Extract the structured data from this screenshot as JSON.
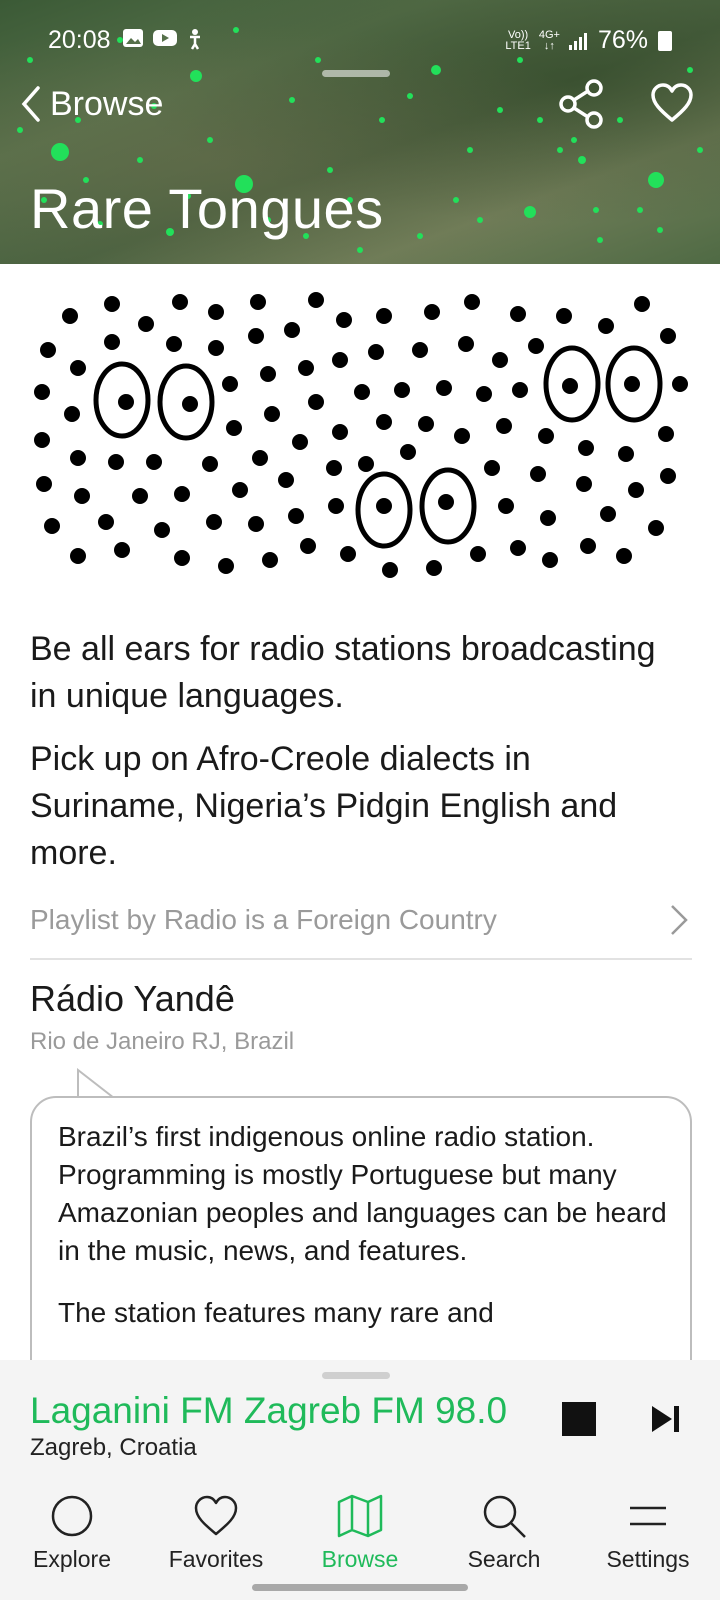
{
  "status_bar": {
    "time": "20:08",
    "network_top": "Vo))",
    "network_bottom": "LTE1",
    "network_type_top": "4G+",
    "network_type_bottom": "↓↑",
    "battery": "76%"
  },
  "header": {
    "back_label": "Browse",
    "title": "Rare Tongues"
  },
  "description": {
    "line1": "Be all ears for radio stations broadcasting in unique languages.",
    "line2": "Pick up on Afro-Creole dialects in Suriname, Nigeria’s Pidgin English and more."
  },
  "playlist": {
    "label": "Playlist by Radio is a Foreign Country"
  },
  "station": {
    "name": "Rádio Yandê",
    "location": "Rio de Janeiro RJ, Brazil",
    "bubble_p1": "Brazil’s first indigenous online radio station. Programming is mostly Portuguese but many Amazonian peoples and languages can be heard in the music, news, and features.",
    "bubble_p2": "The station features many rare and"
  },
  "now_playing": {
    "title": "Laganini FM Zagreb FM 98.0",
    "subtitle": "Zagreb, Croatia"
  },
  "nav": {
    "explore": "Explore",
    "favorites": "Favorites",
    "browse": "Browse",
    "search": "Search",
    "settings": "Settings"
  },
  "colors": {
    "accent": "#1fba5a",
    "header_dots": "#22e05a"
  }
}
